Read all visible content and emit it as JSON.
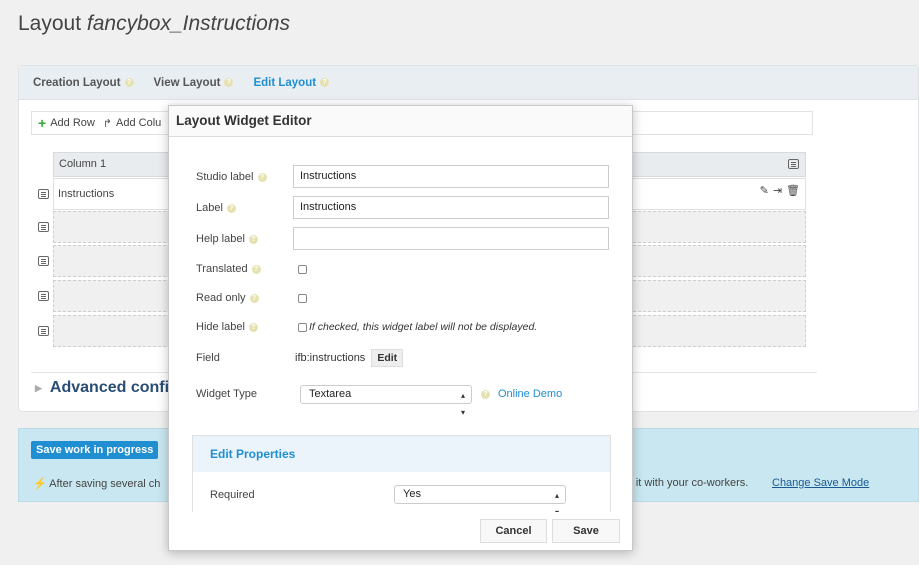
{
  "page": {
    "title_prefix": "Layout",
    "title_doc": "fancybox_Instructions"
  },
  "tabs": [
    {
      "label": "Creation Layout"
    },
    {
      "label": "View Layout"
    },
    {
      "label": "Edit Layout"
    }
  ],
  "toolbar": {
    "add_row": "Add Row",
    "add_column": "Add Colu"
  },
  "column": {
    "header": "Column 1"
  },
  "rows": [
    {
      "label": "Instructions"
    },
    {
      "label": ""
    },
    {
      "label": ""
    },
    {
      "label": ""
    },
    {
      "label": ""
    }
  ],
  "advanced": {
    "label": "Advanced config"
  },
  "save_panel": {
    "button": "Save work in progress",
    "note_start": "After saving several ch",
    "note_end": "re it with your co-workers.",
    "link": "Change Save Mode"
  },
  "modal": {
    "title": "Layout Widget Editor",
    "fields": {
      "studio_label": {
        "label": "Studio label",
        "value": "Instructions"
      },
      "label": {
        "label": "Label",
        "value": "Instructions"
      },
      "help_label": {
        "label": "Help label",
        "value": ""
      },
      "translated": {
        "label": "Translated"
      },
      "read_only": {
        "label": "Read only"
      },
      "hide_label": {
        "label": "Hide label",
        "note": "If checked, this widget label will not be displayed."
      },
      "field": {
        "label": "Field",
        "value": "ifb:instructions",
        "edit": "Edit"
      },
      "widget_type": {
        "label": "Widget Type",
        "value": "Textarea",
        "demo": "Online Demo"
      }
    },
    "properties": {
      "title": "Edit Properties",
      "required_label": "Required",
      "required_value": "Yes"
    },
    "footer": {
      "cancel": "Cancel",
      "save": "Save"
    }
  },
  "colors": {
    "accent": "#1f8fd1",
    "panel_blue": "#c9e7f0",
    "add_green": "#3aa63a"
  }
}
